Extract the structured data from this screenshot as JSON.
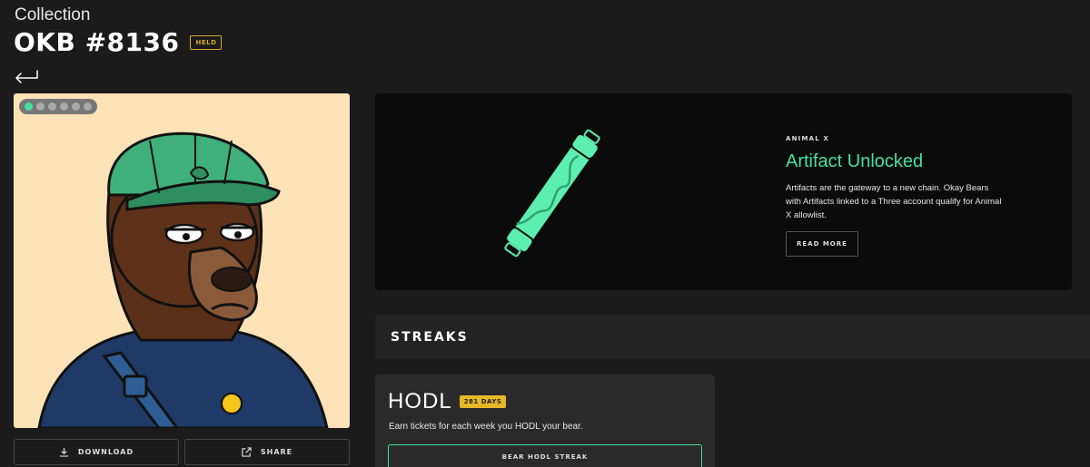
{
  "header": {
    "breadcrumb": "Collection",
    "title": "OKB #8136",
    "held_badge": "HELD"
  },
  "nft": {
    "variant_dots": 6,
    "active_dot": 0,
    "background_color": "#fbe2b7"
  },
  "actions": {
    "download_label": "DOWNLOAD",
    "share_label": "SHARE"
  },
  "artifact": {
    "eyebrow": "ANIMAL X",
    "title": "Artifact Unlocked",
    "description": "Artifacts are the gateway to a new chain. Okay Bears with Artifacts linked to a Three account qualify for Animal X allowlist.",
    "read_more_label": "READ MORE"
  },
  "streaks": {
    "section_title": "STREAKS",
    "hodl": {
      "title": "HODL",
      "days_badge": "281 DAYS",
      "description": "Earn tickets for each week you HODL your bear.",
      "button_label": "BEAR HODL STREAK"
    }
  },
  "colors": {
    "accent": "#46e0a0",
    "badge_gold": "#e8b927",
    "background": "#1b1b1b"
  },
  "icons": [
    "back-arrow-icon",
    "download-icon",
    "share-icon"
  ]
}
